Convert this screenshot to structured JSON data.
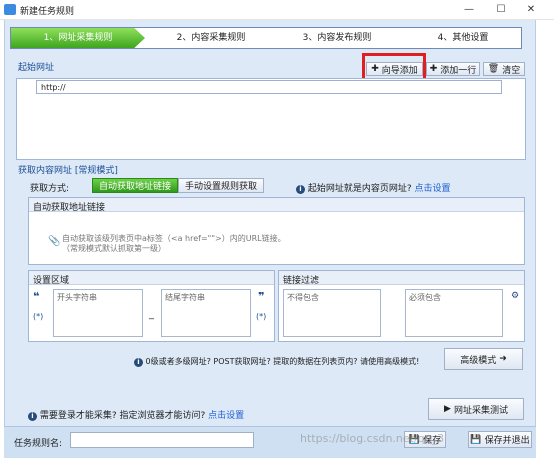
{
  "window": {
    "title": "新建任务规则",
    "min": "—",
    "max": "☐",
    "close": "✕"
  },
  "steps": [
    "1、网址采集规则",
    "2、内容采集规则",
    "3、内容发布规则",
    "4、其他设置"
  ],
  "start": {
    "section": "起始网址",
    "wizard_add": "向导添加",
    "add_one": "添加一行",
    "clear": "清空",
    "url": "http://"
  },
  "content": {
    "section": "获取内容网址 [常规模式]",
    "method_label": "获取方式:",
    "auto_tab": "自动获取地址链接",
    "manual_tab": "手动设置规则获取",
    "is_content_q": "起始网址就是内容页网址?",
    "click_set": "点击设置"
  },
  "auto": {
    "header": "自动获取地址链接",
    "hint1": "自动获取该级列表页中a标签（<a href=\"\">）内的URL链接。",
    "hint2": "（常规模式默认抓取第一级）"
  },
  "region": {
    "header": "设置区域",
    "start_placeholder": "开头字符串",
    "end_placeholder": "结尾字符串",
    "open_quote": "❝",
    "close_quote": "❞",
    "star": "(*)",
    "dash": "_"
  },
  "filter": {
    "header": "链接过滤",
    "exclude_placeholder": "不得包含",
    "include_placeholder": "必须包含"
  },
  "advanced": {
    "question": "0级或者多级网址? POST获取网址? 提取的数据在列表页内? 请使用高级模式!",
    "button": "高级模式"
  },
  "login": {
    "question": "需要登录才能采集? 指定浏览器才能访问?",
    "link": "点击设置"
  },
  "test_button": "网址采集测试",
  "footer": {
    "name_label": "任务规则名:",
    "save": "保存",
    "save_exit": "保存并退出"
  },
  "watermark": "https://blog.csdn.net/qq_3"
}
